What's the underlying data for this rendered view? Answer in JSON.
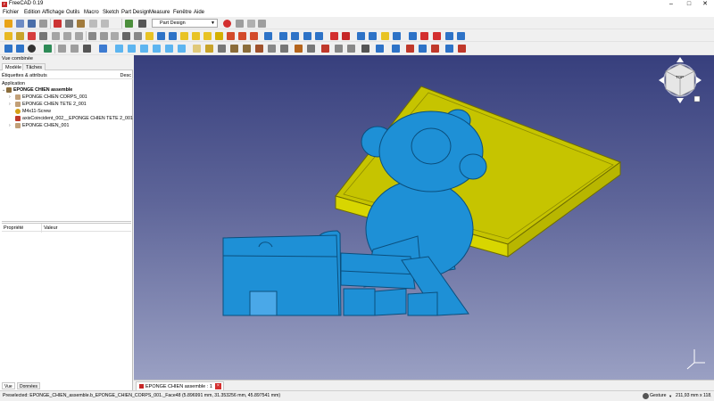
{
  "window": {
    "title": "FreeCAD 0.19",
    "app_icon": "freecad-icon"
  },
  "menu": [
    "Fichier",
    "Edition",
    "Affichage",
    "Outils",
    "Macro",
    "Sketch",
    "Part Design",
    "Measure",
    "Fenêtre",
    "Aide"
  ],
  "toolbar": {
    "workbench": "Part Design"
  },
  "panel": {
    "title": "Vue combinée",
    "tabs": [
      "Modèle",
      "Tâches"
    ],
    "tree_header": "Étiquettes & attributs",
    "tree_header_right": "Desc",
    "tree_root": "Application",
    "tree": [
      {
        "label": "EPONGE CHIEN assemble",
        "bold": true,
        "depth": 0,
        "icon": "assembly-icon"
      },
      {
        "label": "EPONGE CHIEN CORPS_001",
        "depth": 1,
        "icon": "part-icon"
      },
      {
        "label": "EPONGE CHIEN TETE 2_001",
        "depth": 1,
        "icon": "part-icon"
      },
      {
        "label": "M4x11-Screw",
        "depth": 1,
        "icon": "screw-icon"
      },
      {
        "label": "axisCoincident_002__EPONGE CHIEN TETE 2_001",
        "depth": 1,
        "icon": "constraint-icon"
      },
      {
        "label": "EPONGE CHIEN_001",
        "depth": 1,
        "icon": "part-icon"
      }
    ],
    "prop_header": {
      "col1": "Propriété",
      "col2": "Valeur"
    },
    "bottom_tabs": [
      "Vue",
      "Données"
    ]
  },
  "view": {
    "doc_tab": "EPONGE CHIEN assemble : 1",
    "navcube_face": "TOP",
    "colors": {
      "body": "#1e90d6",
      "plate": "#c8c800"
    }
  },
  "status": {
    "preselected": "Preselected: EPONGE_CHIEN_assemble.b_EPONGE_CHIEN_CORPS_001._Face48 (5.896991 mm, 31.353256 mm, 45.897541 mm)",
    "nav_style": "Gesture",
    "dimensions": "211,93 mm x 118,70 mm"
  }
}
